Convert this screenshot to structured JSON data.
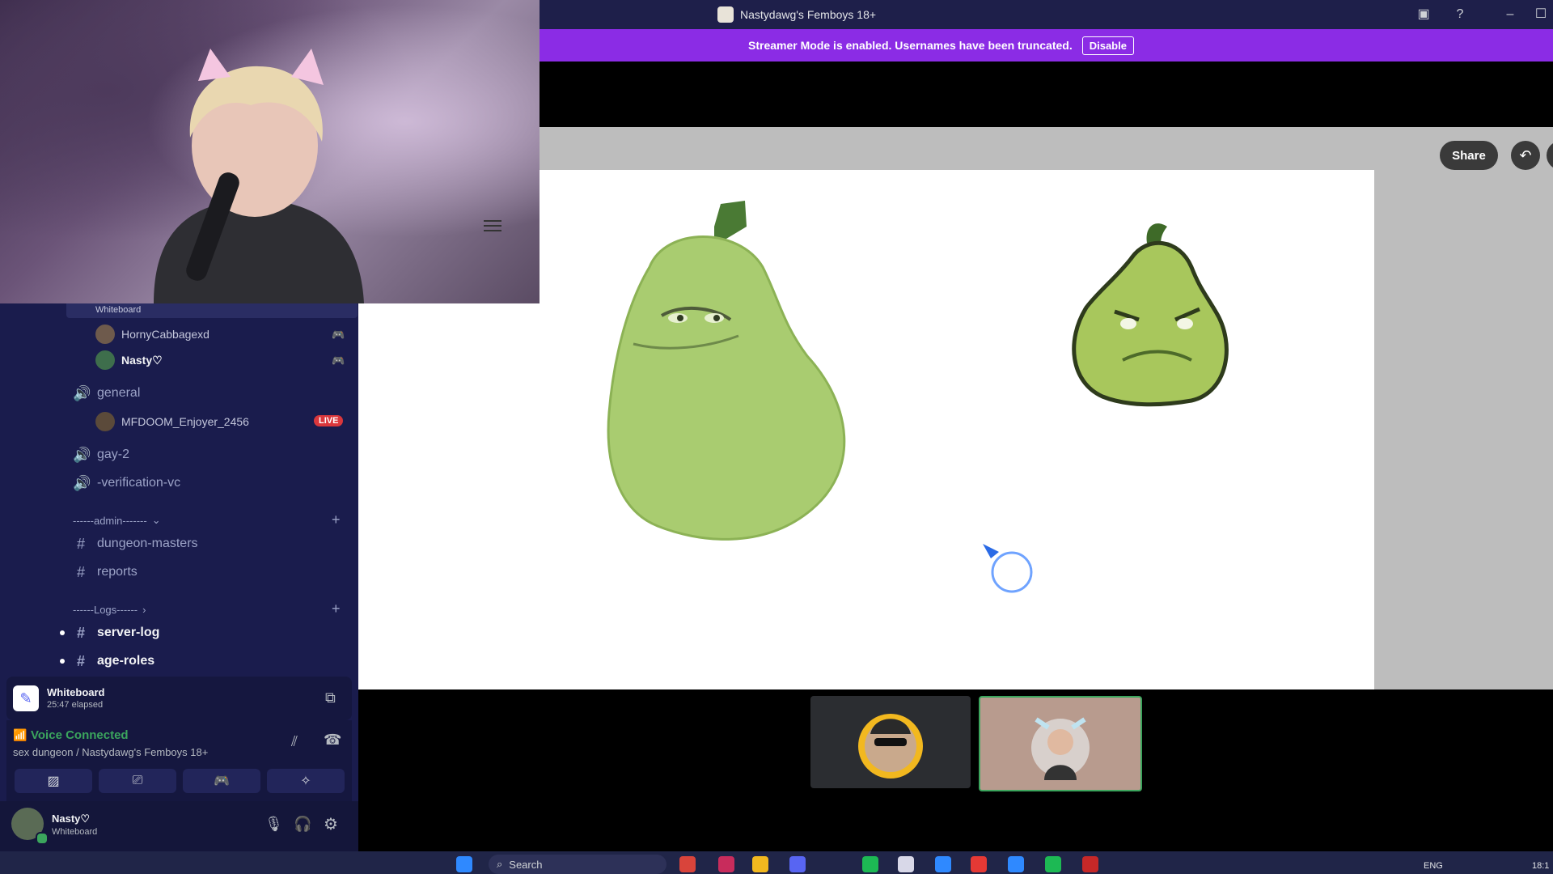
{
  "window": {
    "title": "Nastydawg's Femboys 18+"
  },
  "banner": {
    "message": "Streamer Mode is enabled. Usernames have been truncated.",
    "disable_label": "Disable"
  },
  "activity": {
    "share_label": "Share"
  },
  "sidebar": {
    "whiteboard_label": "Whiteboard",
    "users_top": [
      {
        "name": "HornyCabbagexd"
      },
      {
        "name": "Nasty♡"
      }
    ],
    "channels": [
      {
        "name": "general",
        "type": "voice"
      },
      {
        "name": "gay-2",
        "type": "voice"
      },
      {
        "name": "-verification-vc",
        "type": "voice"
      }
    ],
    "general_user": {
      "name": "MFDOOM_Enjoyer_2456",
      "badge": "LIVE"
    },
    "admin_category": "------admin-------",
    "admin_channels": [
      "dungeon-masters",
      "reports"
    ],
    "logs_category": "------Logs------",
    "logs_channels": [
      "server-log",
      "age-roles"
    ]
  },
  "activity_panel": {
    "name": "Whiteboard",
    "elapsed": "25:47 elapsed"
  },
  "voice": {
    "status": "Voice Connected",
    "location": "sex dungeon / Nastydawg's Femboys 18+"
  },
  "user_panel": {
    "name": "Nasty♡",
    "activity": "Whiteboard"
  },
  "taskbar": {
    "search_placeholder": "Search",
    "language": "ENG",
    "clock": "18:1"
  },
  "colors": {
    "banner": "#8b2ce5",
    "sidebar": "#1a1c4d",
    "voice_connected": "#3ba55d",
    "live_badge": "#da373c"
  }
}
